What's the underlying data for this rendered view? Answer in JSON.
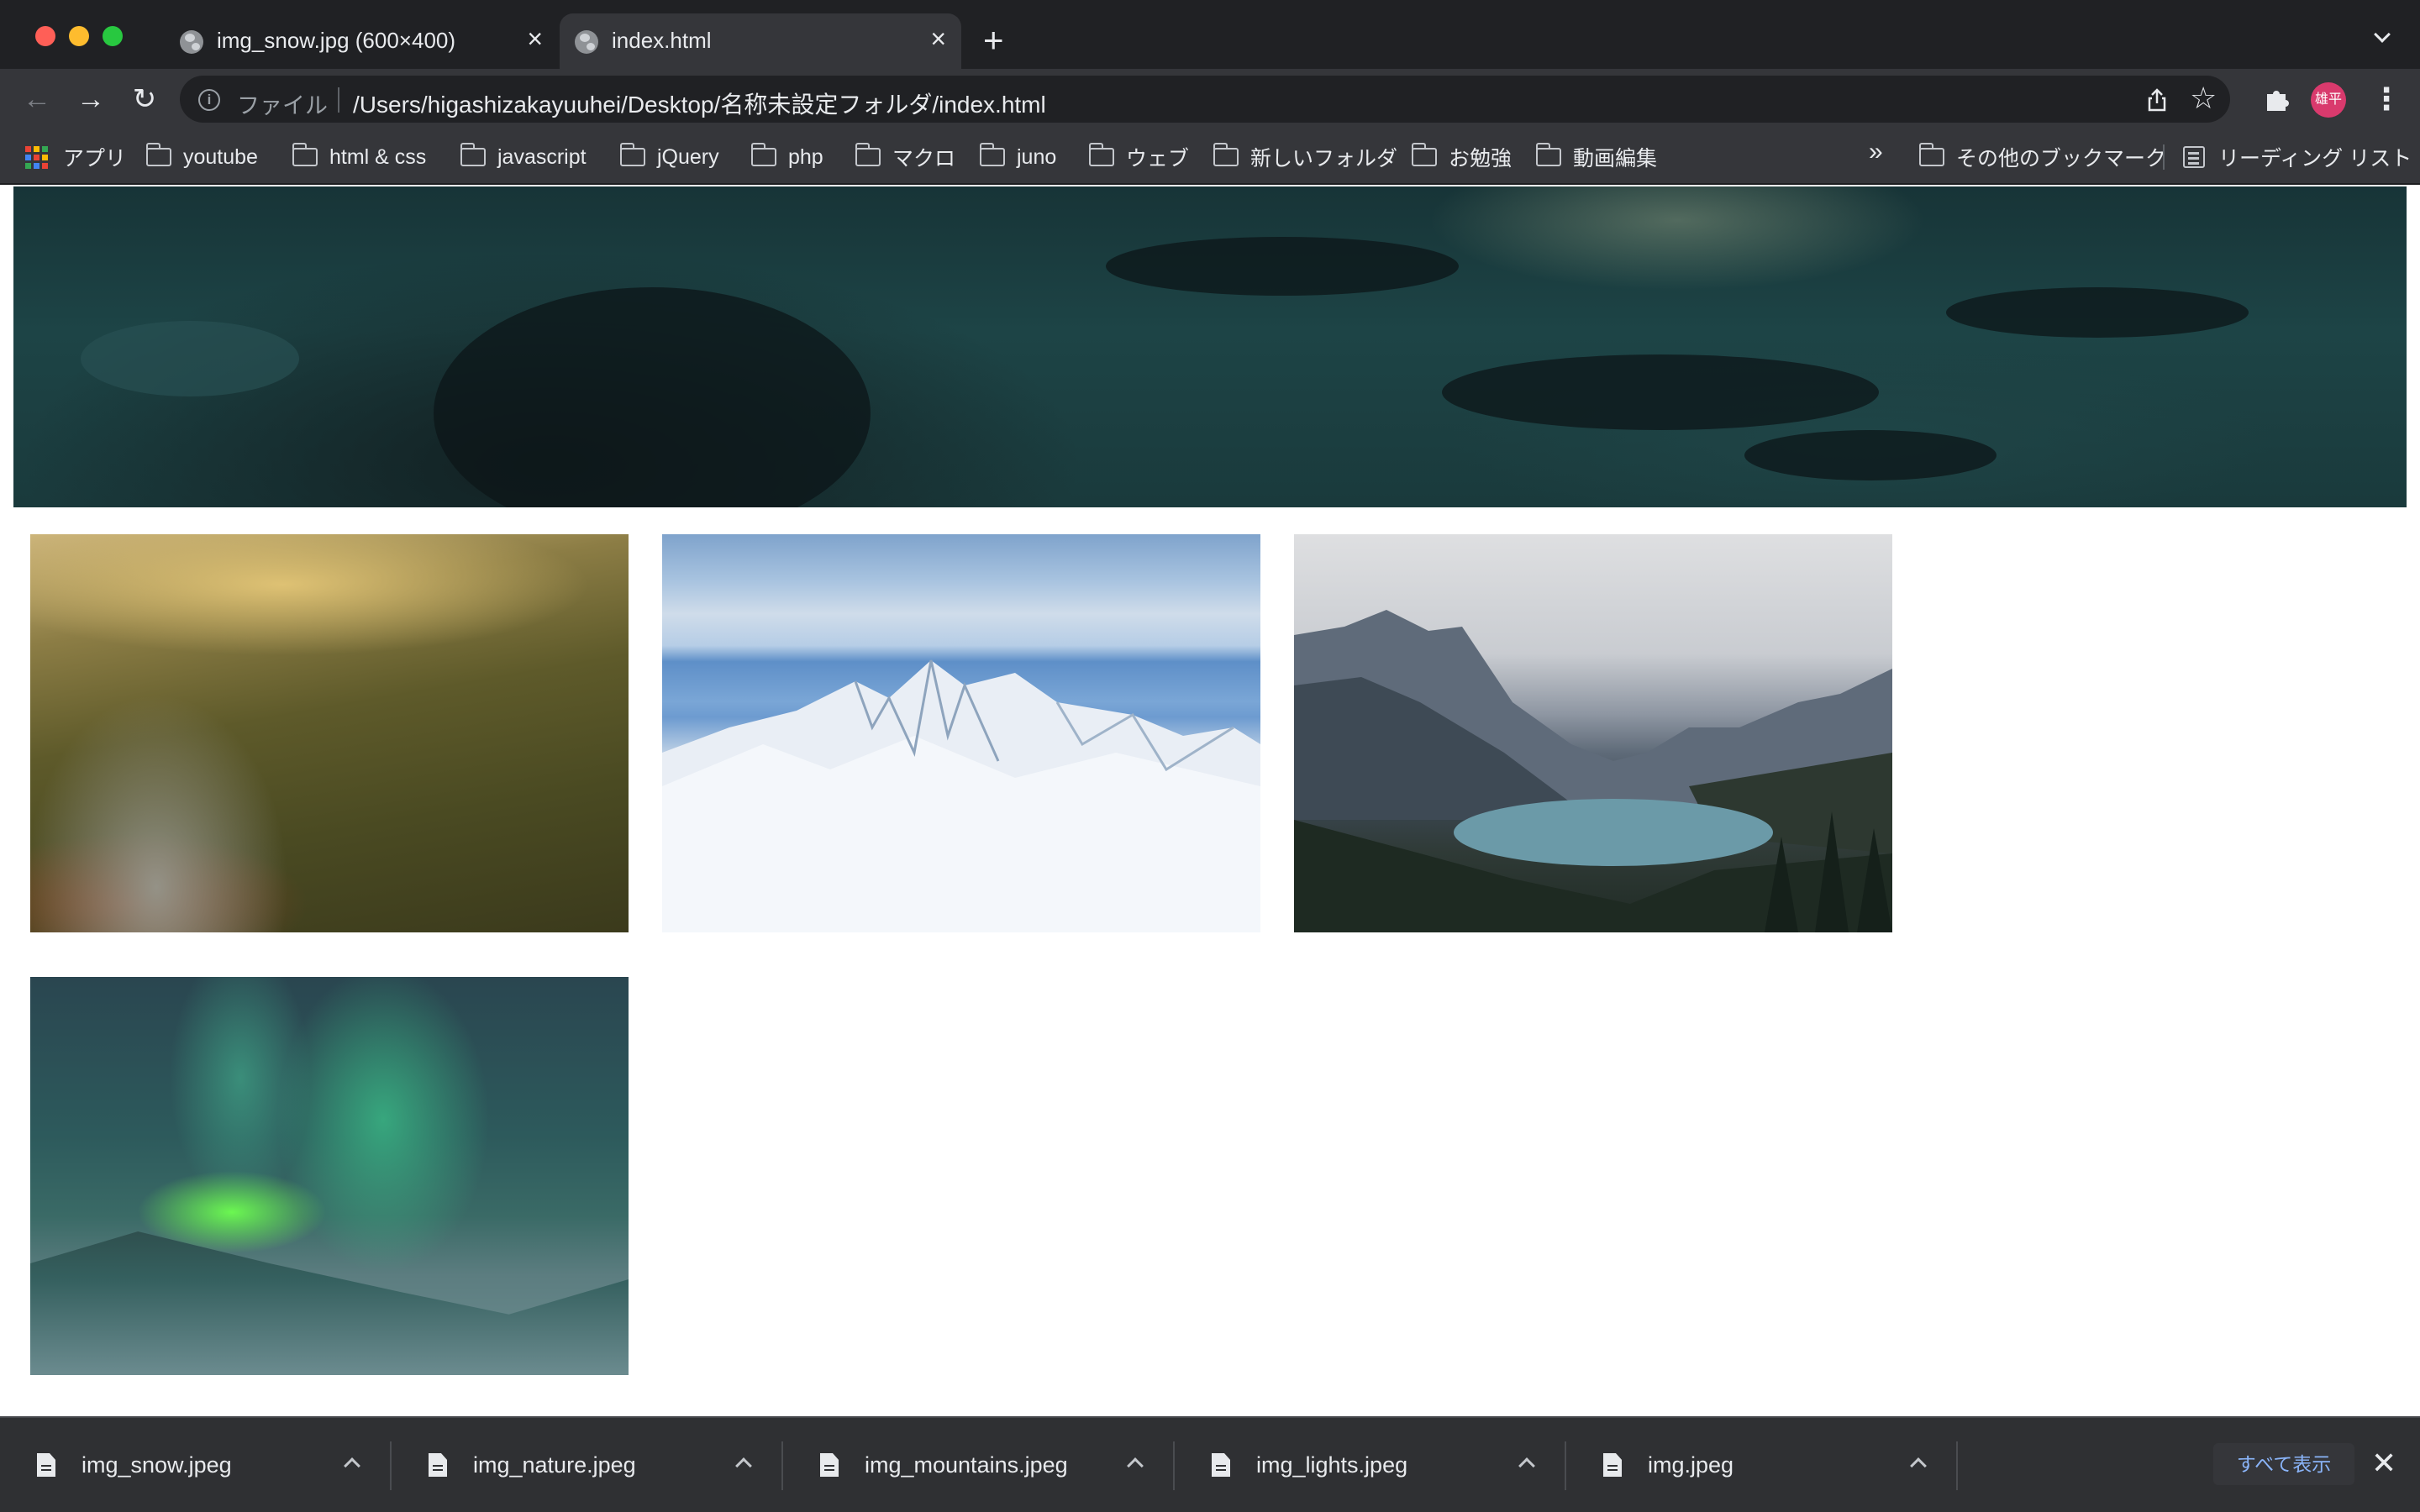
{
  "window": {
    "controls": [
      "close",
      "minimize",
      "zoom"
    ]
  },
  "tabs": [
    {
      "title": "img_snow.jpg (600×400)",
      "active": false,
      "icon": "globe-icon"
    },
    {
      "title": "index.html",
      "active": true,
      "icon": "globe-icon"
    }
  ],
  "toolbar": {
    "new_tab": "+",
    "back_icon": "←",
    "forward_icon": "→",
    "reload_icon": "↻",
    "scheme_label": "ファイル",
    "url": "/Users/higashizakayuuhei/Desktop/名称未設定フォルダ/index.html",
    "star_icon": "☆",
    "avatar_text": "雄平",
    "menu_icon": "⋮"
  },
  "bookmarks": {
    "items": [
      {
        "label": "アプリ",
        "icon": "apps-grid-icon"
      },
      {
        "label": "youtube",
        "icon": "folder-icon"
      },
      {
        "label": "html & css",
        "icon": "folder-icon"
      },
      {
        "label": "javascript",
        "icon": "folder-icon"
      },
      {
        "label": "jQuery",
        "icon": "folder-icon"
      },
      {
        "label": "php",
        "icon": "folder-icon"
      },
      {
        "label": "マクロ",
        "icon": "folder-icon"
      },
      {
        "label": "juno",
        "icon": "folder-icon"
      },
      {
        "label": "ウェブ",
        "icon": "folder-icon"
      },
      {
        "label": "新しいフォルダ",
        "icon": "folder-icon"
      },
      {
        "label": "お勉強",
        "icon": "folder-icon"
      },
      {
        "label": "動画編集",
        "icon": "folder-icon"
      }
    ],
    "overflow": "»",
    "other": "その他のブックマーク",
    "reading_list": "リーディング リスト"
  },
  "page": {
    "images": [
      {
        "name": "hero-image",
        "subject": "dark snowy mountainside"
      },
      {
        "name": "photo-nature",
        "subject": "forested valley with cliff"
      },
      {
        "name": "photo-snow",
        "subject": "snowy mountain peaks"
      },
      {
        "name": "photo-mountains",
        "subject": "mountain lake"
      },
      {
        "name": "photo-lights",
        "subject": "aurora over snowy ridge"
      }
    ]
  },
  "downloads": {
    "items": [
      {
        "filename": "img_snow.jpeg"
      },
      {
        "filename": "img_nature.jpeg"
      },
      {
        "filename": "img_mountains.jpeg"
      },
      {
        "filename": "img_lights.jpeg"
      },
      {
        "filename": "img.jpeg"
      }
    ],
    "show_all": "すべて表示",
    "close_icon": "✕"
  },
  "colors": {
    "chrome_dark": "#202124",
    "chrome_toolbar": "#35363a",
    "text_light": "#e8eaed",
    "link_blue": "#8ab4f8",
    "avatar_pink": "#d93a6d"
  }
}
